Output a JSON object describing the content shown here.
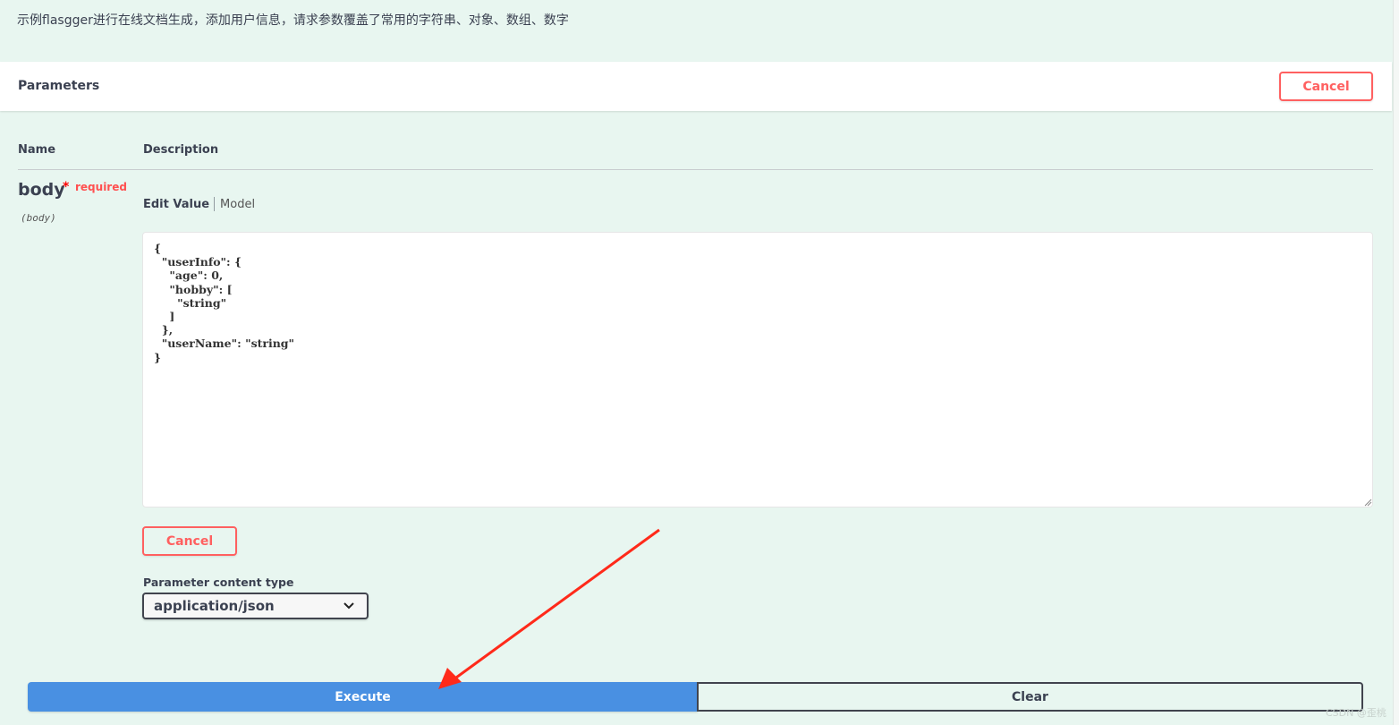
{
  "operation": {
    "description": "示例flasgger进行在线文档生成，添加用户信息，请求参数覆盖了常用的字符串、对象、数组、数字"
  },
  "parameters_section": {
    "title": "Parameters",
    "cancel_label": "Cancel"
  },
  "table": {
    "col_name": "Name",
    "col_description": "Description"
  },
  "param": {
    "name": "body",
    "required_star": "*",
    "required_label": "required",
    "location": "(body)",
    "tab_edit_value": "Edit Value",
    "tab_model": "Model",
    "body_value": "{\n  \"userInfo\": {\n    \"age\": 0,\n    \"hobby\": [\n      \"string\"\n    ]\n  },\n  \"userName\": \"string\"\n}",
    "cancel_label": "Cancel"
  },
  "content_type": {
    "label": "Parameter content type",
    "selected": "application/json"
  },
  "actions": {
    "execute_label": "Execute",
    "clear_label": "Clear"
  },
  "annotation": {
    "arrow_color": "#ff2a1a"
  },
  "watermark": "CSDN @歪桃",
  "colors": {
    "background": "#e8f6f0",
    "execute_blue": "#4990e2",
    "cancel_red": "#ff6060"
  }
}
